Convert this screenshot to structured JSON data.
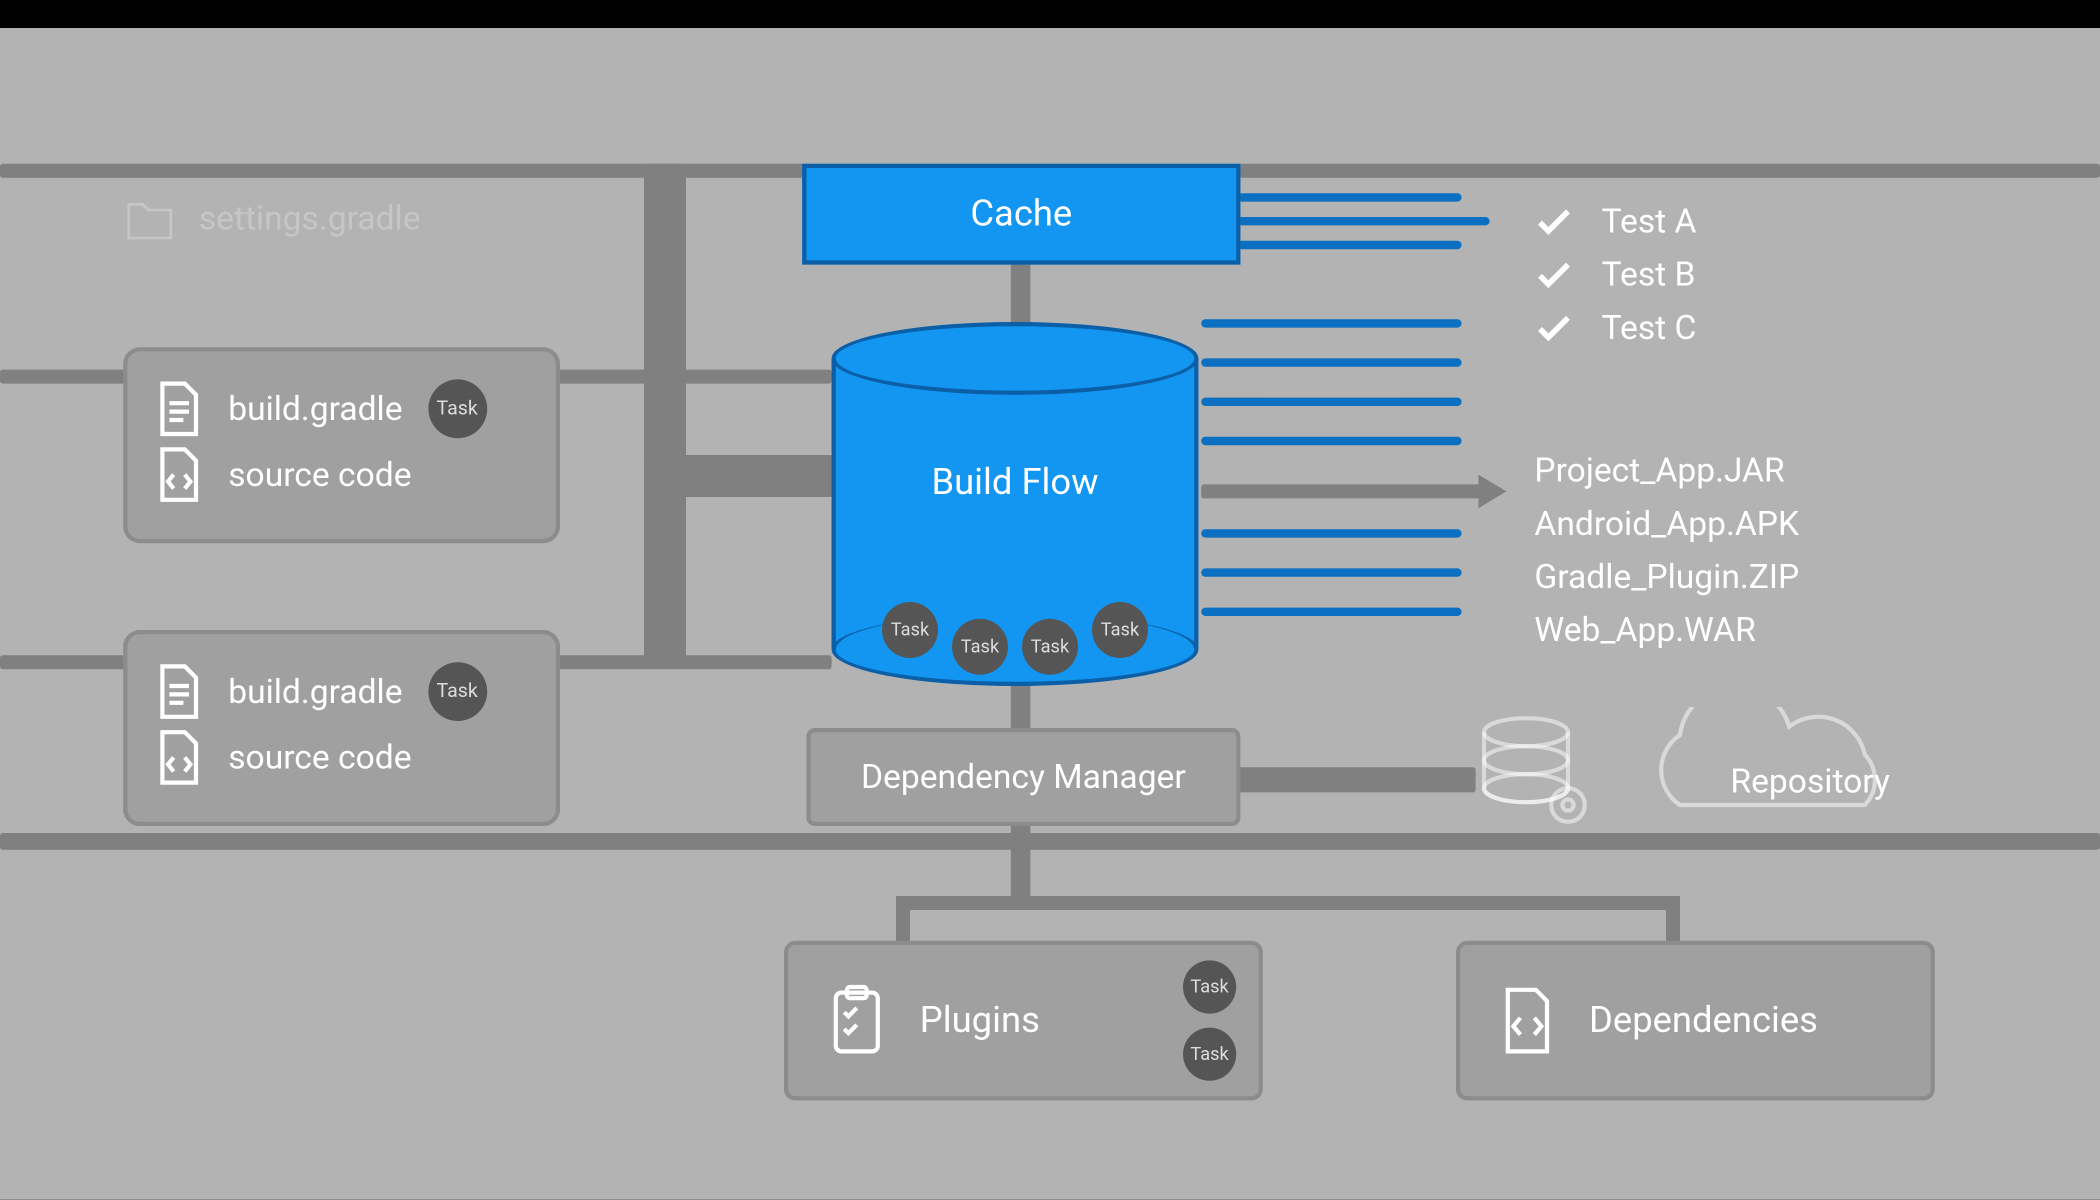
{
  "colors": {
    "accent": "#1296f2",
    "accent_border": "#0b5fa6",
    "panel": "#a0a0a0",
    "panel_border": "#8c8c8c",
    "bg": "#b3b3b3"
  },
  "settings_file": "settings.gradle",
  "projects": [
    {
      "build_file": "build.gradle",
      "source_label": "source code",
      "task_label": "Task"
    },
    {
      "build_file": "build.gradle",
      "source_label": "source code",
      "task_label": "Task"
    }
  ],
  "cache": {
    "label": "Cache"
  },
  "build_flow": {
    "label": "Build Flow",
    "tasks": [
      "Task",
      "Task",
      "Task",
      "Task"
    ]
  },
  "dependency_manager": {
    "label": "Dependency Manager"
  },
  "plugins": {
    "label": "Plugins",
    "tasks": [
      "Task",
      "Task"
    ]
  },
  "dependencies_card": {
    "label": "Dependencies"
  },
  "tests": [
    "Test A",
    "Test B",
    "Test C"
  ],
  "artifacts": [
    "Project_App.JAR",
    "Android_App.APK",
    "Gradle_Plugin.ZIP",
    "Web_App.WAR"
  ],
  "repository": {
    "label": "Repository"
  }
}
